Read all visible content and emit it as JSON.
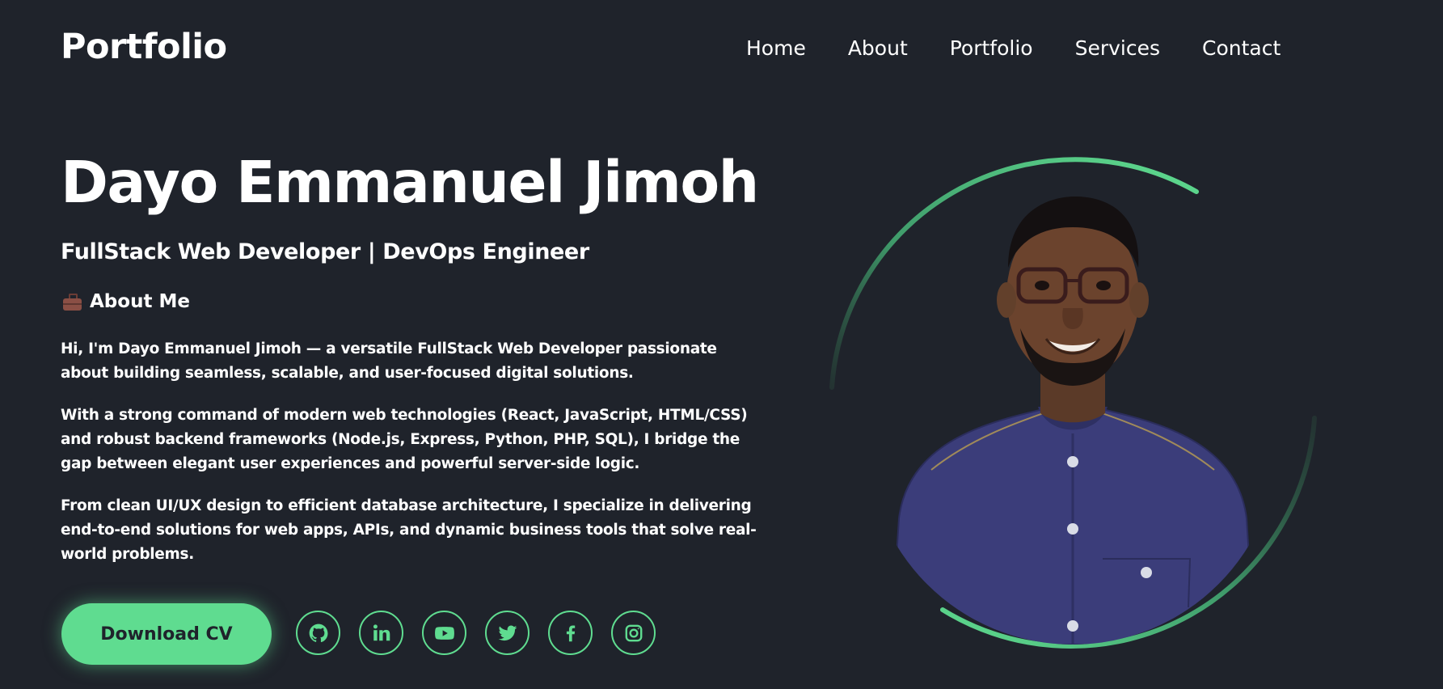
{
  "header": {
    "logo": "Portfolio",
    "nav": [
      {
        "label": "Home"
      },
      {
        "label": "About"
      },
      {
        "label": "Portfolio"
      },
      {
        "label": "Services"
      },
      {
        "label": "Contact"
      }
    ]
  },
  "hero": {
    "name": "Dayo Emmanuel Jimoh",
    "role": "FullStack Web Developer | DevOps Engineer",
    "about_heading": "About Me",
    "about_icon": "briefcase-icon",
    "paragraphs": [
      "Hi, I'm Dayo Emmanuel Jimoh — a versatile FullStack Web Developer passionate about building seamless, scalable, and user-focused digital solutions.",
      "With a strong command of modern web technologies (React, JavaScript, HTML/CSS) and robust backend frameworks (Node.js, Express, Python, PHP, SQL), I bridge the gap between elegant user experiences and powerful server-side logic.",
      "From clean UI/UX design to efficient database architecture, I specialize in delivering end-to-end solutions for web apps, APIs, and dynamic business tools that solve real-world problems."
    ],
    "cv_button": "Download CV",
    "socials": [
      {
        "icon": "github-icon"
      },
      {
        "icon": "linkedin-icon"
      },
      {
        "icon": "youtube-icon"
      },
      {
        "icon": "twitter-icon"
      },
      {
        "icon": "facebook-icon"
      },
      {
        "icon": "instagram-icon"
      }
    ]
  },
  "colors": {
    "background": "#1f232b",
    "accent": "#5fdc90",
    "text": "#ffffff"
  }
}
